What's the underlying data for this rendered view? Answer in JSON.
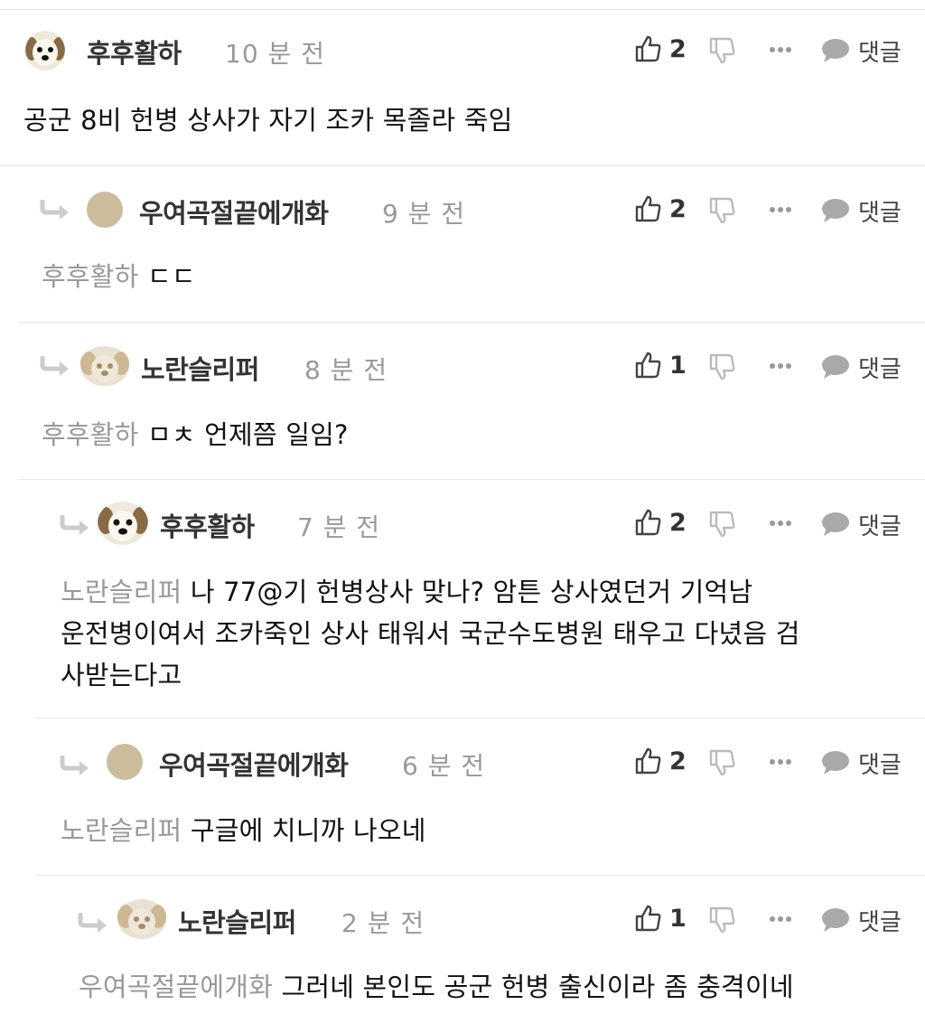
{
  "comments": [
    {
      "nick": "후후활하",
      "time": "10 분 전",
      "likes": "2",
      "reply_label": "댓글",
      "mention": "",
      "lines": [
        "공군 8비 헌병 상사가 자기 조카 목졸라 죽임"
      ],
      "avatar": "puppy-face"
    },
    {
      "nick": "우여곡절끝에개화",
      "time": "9 분 전",
      "likes": "2",
      "reply_label": "댓글",
      "mention": "후후활하",
      "lines": [
        "ㄷㄷ"
      ],
      "avatar": "beige-circle"
    },
    {
      "nick": "노란슬리퍼",
      "time": "8 분 전",
      "likes": "1",
      "reply_label": "댓글",
      "mention": "후후활하",
      "lines": [
        "ㅁㅊ 언제쯤 일임?"
      ],
      "avatar": "blurry-puppy"
    },
    {
      "nick": "후후활하",
      "time": "7 분 전",
      "likes": "2",
      "reply_label": "댓글",
      "mention": "노란슬리퍼",
      "lines": [
        "나 77@기 헌병상사 맞나? 암튼 상사였던거 기억남",
        "운전병이여서 조카죽인 상사 태워서 국군수도병원 태우고 다녔음 검",
        "사받는다고"
      ],
      "avatar": "puppy-face"
    },
    {
      "nick": "우여곡절끝에개화",
      "time": "6 분 전",
      "likes": "2",
      "reply_label": "댓글",
      "mention": "노란슬리퍼",
      "lines": [
        "구글에 치니까 나오네"
      ],
      "avatar": "beige-circle"
    },
    {
      "nick": "노란슬리퍼",
      "time": "2 분 전",
      "likes": "1",
      "reply_label": "댓글",
      "mention": "우여곡절끝에개화",
      "lines": [
        "그러네 본인도 공군 헌병 출신이라 좀 충격이네"
      ],
      "avatar": "blurry-puppy"
    }
  ],
  "icons": {
    "like": "thumbs-up-icon",
    "dislike": "thumbs-down-icon",
    "more": "more-dots-icon",
    "reply": "speech-bubble-icon",
    "reply_arrow": "reply-arrow-icon"
  },
  "colors": {
    "nickname": "#333333",
    "timestamp": "#999999",
    "mention": "#999999",
    "divider": "#e6e6e6",
    "icon": "#555555",
    "reply_arrow": "#cccccc",
    "avatar_beige": "#cbbd9c"
  }
}
